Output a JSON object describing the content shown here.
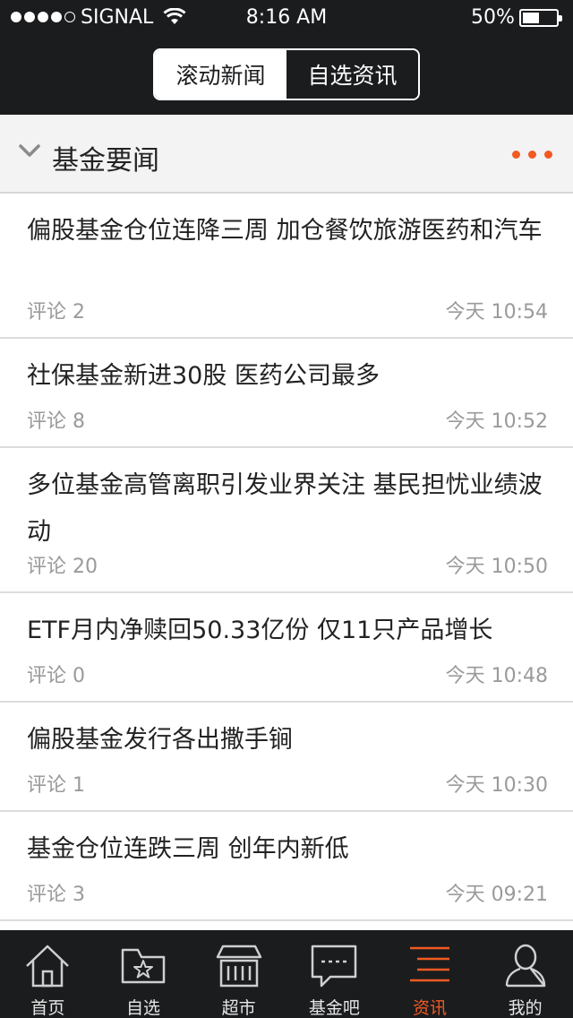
{
  "status_bar": {
    "carrier": "SIGNAL",
    "time": "8:16 AM",
    "battery": "50%",
    "battery_level": 0.5
  },
  "segmented_control": {
    "options": [
      "滚动新闻",
      "自选资讯"
    ],
    "selected": "自选资讯"
  },
  "section": {
    "title": "基金要闻",
    "accent_color": "#f15a22"
  },
  "news": [
    {
      "title": "偏股基金仓位连降三周  加仓餐饮旅游医药和汽车",
      "comment": "评论  2",
      "time": "今天 10:54"
    },
    {
      "title": "社保基金新进30股  医药公司最多",
      "comment": "评论  8",
      "time": "今天 10:52"
    },
    {
      "title": "多位基金高管离职引发业界关注  基民担忧业绩波动",
      "comment": "评论  20",
      "time": "今天 10:50"
    },
    {
      "title": "ETF月内净赎回50.33亿份  仅11只产品增长",
      "comment": "评论  0",
      "time": "今天 10:48"
    },
    {
      "title": "偏股基金发行各出撒手锏",
      "comment": "评论  1",
      "time": "今天 10:30"
    },
    {
      "title": "基金仓位连跌三周  创年内新低",
      "comment": "评论  3",
      "time": "今天 09:21"
    }
  ],
  "tabbar": {
    "items": [
      {
        "label": "首页",
        "icon": "home-icon"
      },
      {
        "label": "自选",
        "icon": "star-folder-icon"
      },
      {
        "label": "超市",
        "icon": "store-icon"
      },
      {
        "label": "基金吧",
        "icon": "chat-bubble-icon"
      },
      {
        "label": "资讯",
        "icon": "news-list-icon"
      },
      {
        "label": "我的",
        "icon": "user-icon"
      }
    ],
    "active": "资讯",
    "active_color": "#f15a22"
  }
}
